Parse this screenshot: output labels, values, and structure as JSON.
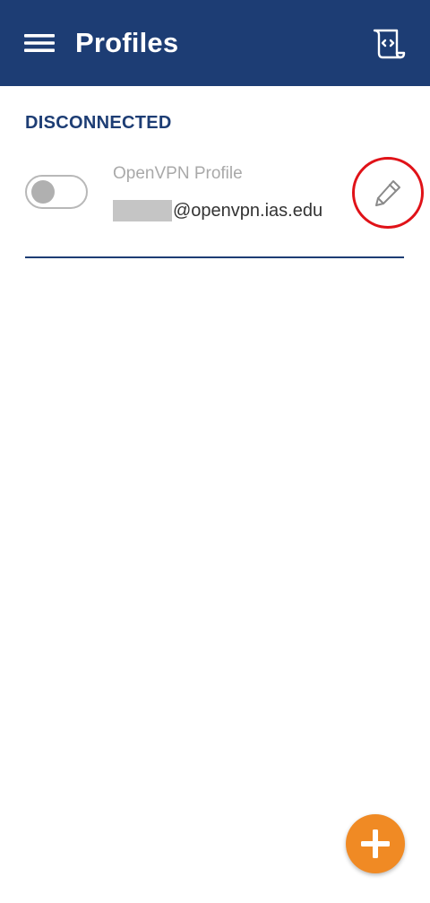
{
  "app_bar": {
    "title": "Profiles",
    "menu_icon": "hamburger-menu-icon",
    "log_icon": "log-file-icon",
    "background_color": "#1d3d74"
  },
  "status": {
    "label": "DISCONNECTED",
    "color": "#1d3d74"
  },
  "profiles": [
    {
      "name": "OpenVPN Profile",
      "account_domain": "@openvpn.ias.edu",
      "connected": false,
      "edit_icon": "pencil-icon"
    }
  ],
  "fab": {
    "icon": "plus-icon",
    "color": "#f08a24"
  },
  "highlight_color": "#e01218"
}
